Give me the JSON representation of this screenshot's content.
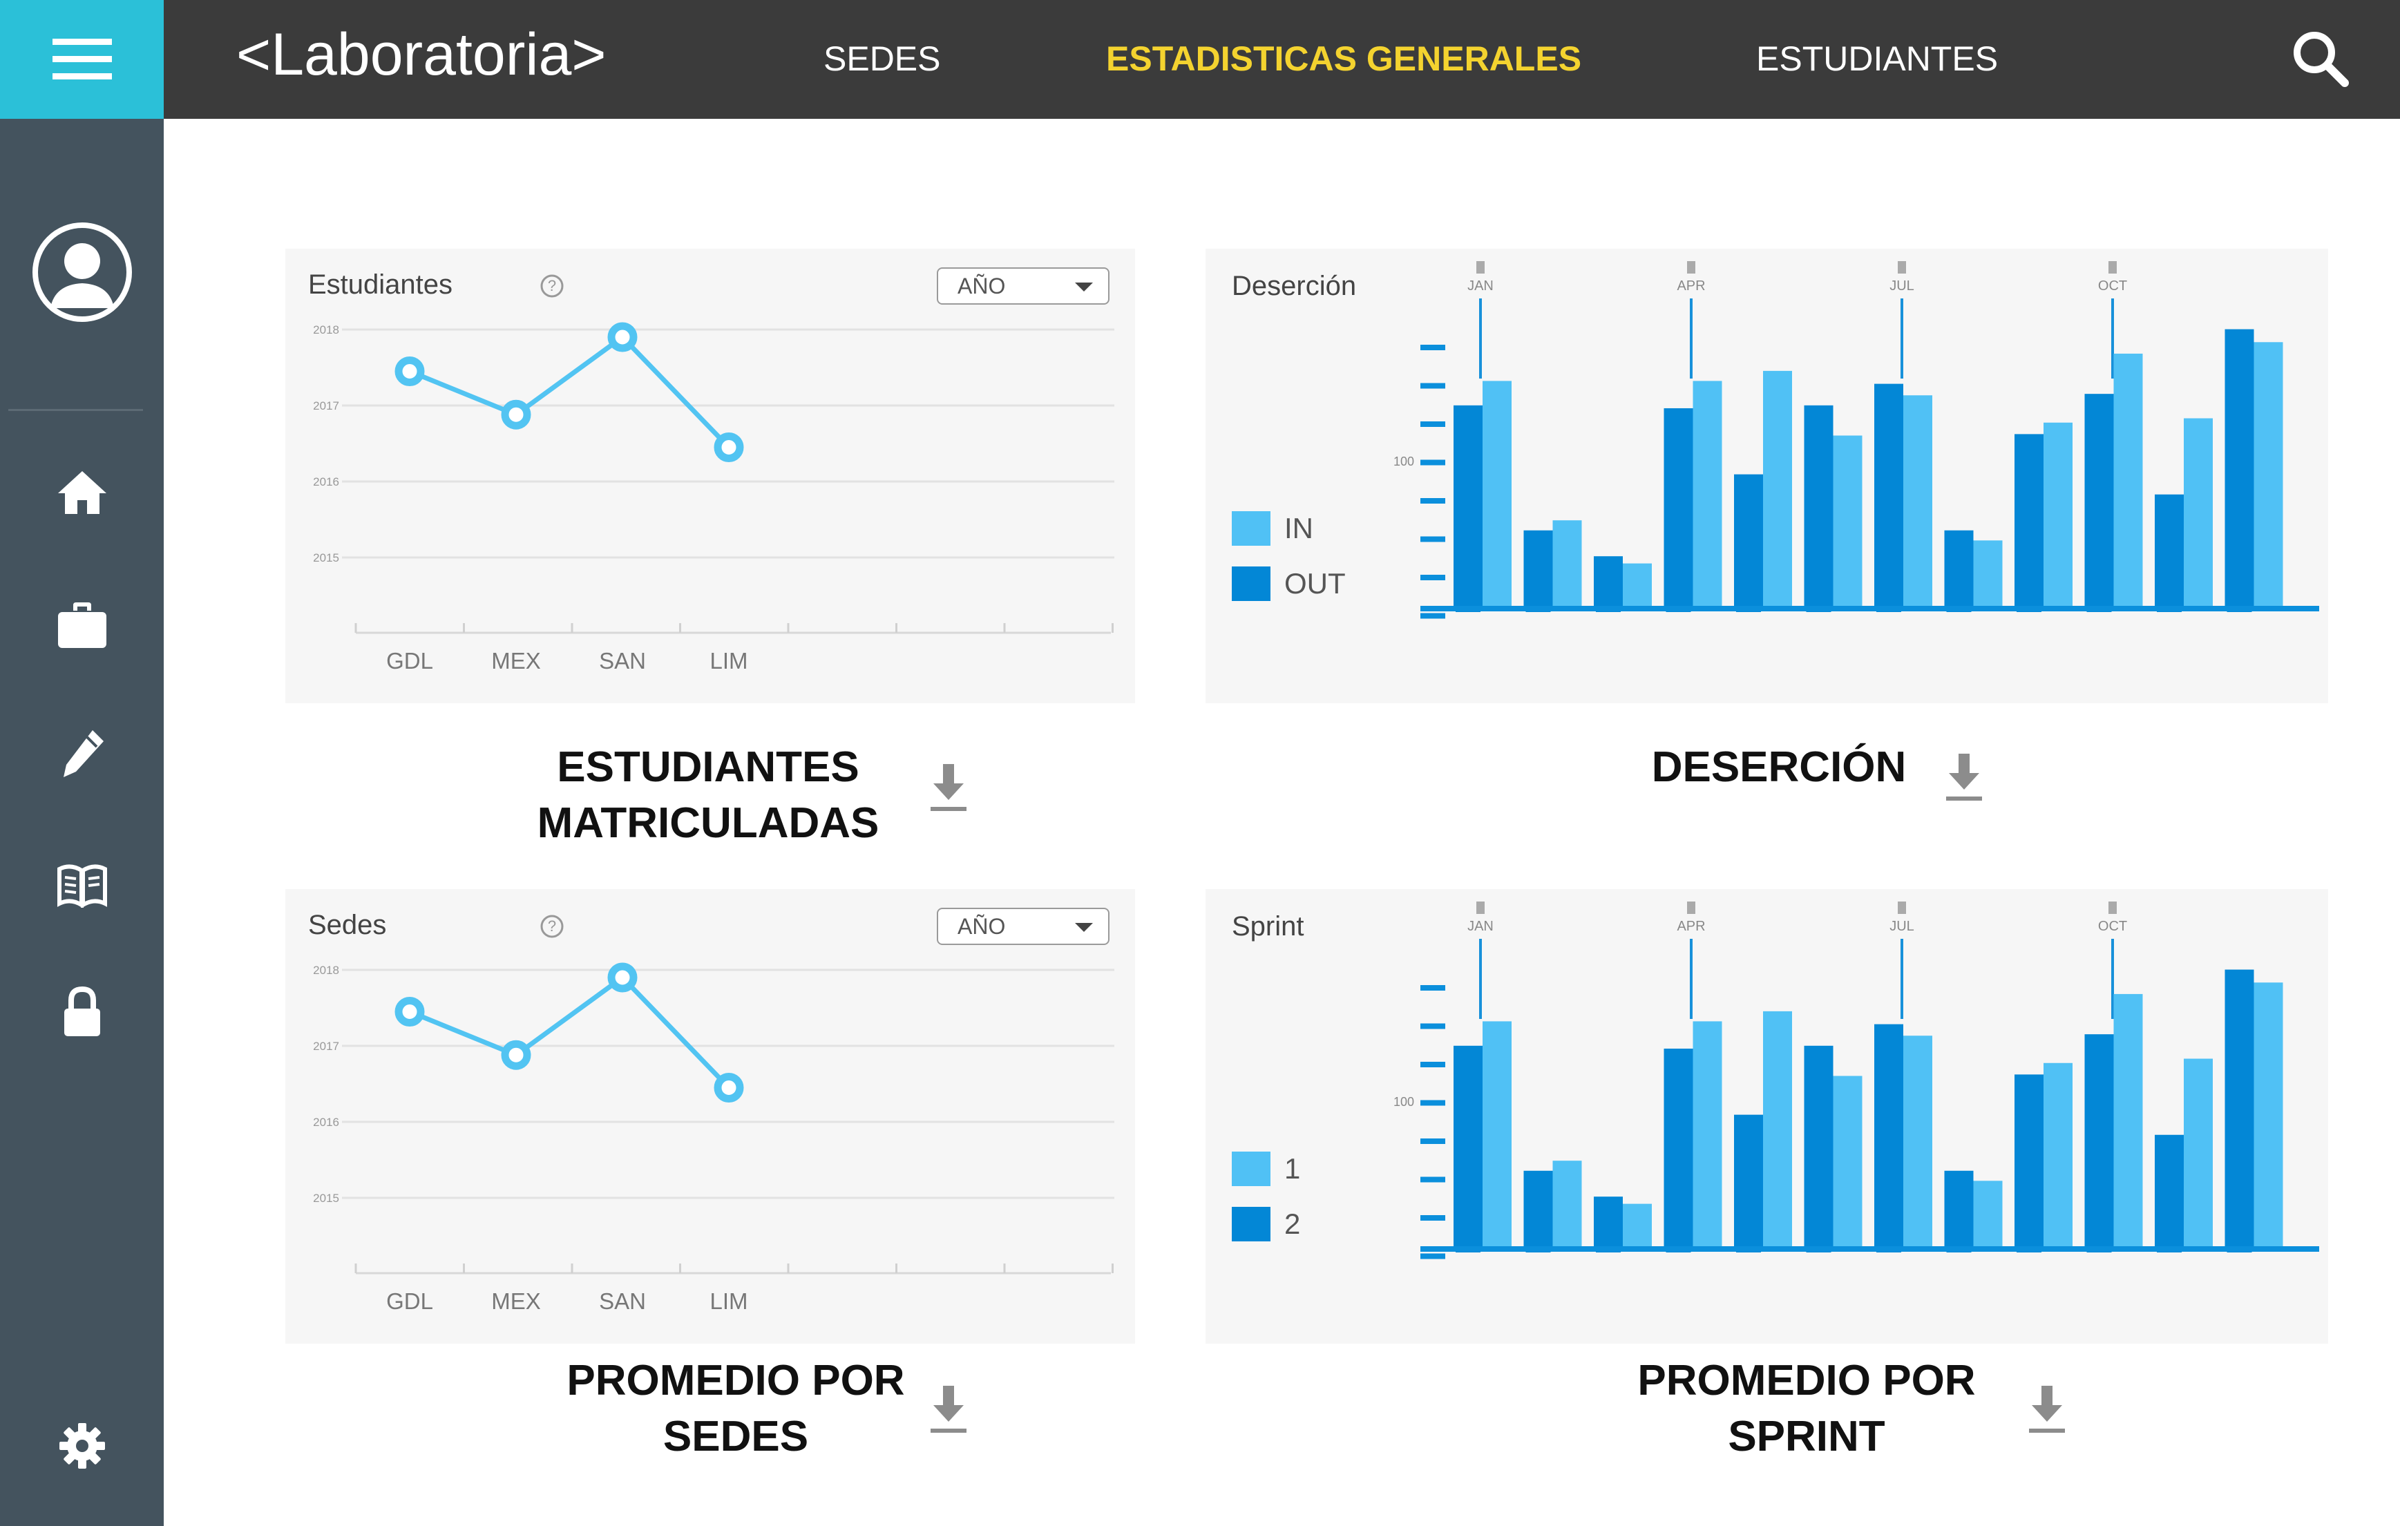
{
  "app": {
    "brand": "<Laboratoria>",
    "nav": [
      {
        "label": "SEDES",
        "active": false
      },
      {
        "label": "ESTADISTICAS GENERALES",
        "active": true
      },
      {
        "label": "ESTUDIANTES",
        "active": false
      }
    ]
  },
  "colors": {
    "menu_accent": "#2bc0d8",
    "topbar": "#3b3b3b",
    "sidebar": "#44535e",
    "nav_active": "#f4d32f",
    "line_series": "#52c4f2",
    "bar_dark": "#0387d6",
    "bar_light": "#50c1f5"
  },
  "sidebar": {
    "icons": [
      "menu-icon",
      "avatar-icon",
      "home-icon",
      "briefcase-icon",
      "pencil-icon",
      "book-icon",
      "lock-icon",
      "settings-icon"
    ]
  },
  "cards": {
    "estudiantes": {
      "title": "Estudiantes",
      "select_value": "AÑO",
      "caption_l1": "ESTUDIANTES",
      "caption_l2": "MATRICULADAS"
    },
    "desercion": {
      "title": "Deserción",
      "legend": [
        "IN",
        "OUT"
      ],
      "caption_l1": "DESERCIÓN"
    },
    "sedes": {
      "title": "Sedes",
      "select_value": "AÑO",
      "caption_l1": "PROMEDIO POR",
      "caption_l2": "SEDES"
    },
    "sprint": {
      "title": "Sprint",
      "legend": [
        "1",
        "2"
      ],
      "caption_l1": "PROMEDIO POR",
      "caption_l2": "SPRINT"
    }
  },
  "chart_data": [
    {
      "type": "line",
      "title": "Estudiantes",
      "categories": [
        "GDL",
        "MEX",
        "SAN",
        "LIM"
      ],
      "yticks": [
        "2018",
        "2017",
        "2016",
        "2015"
      ],
      "values": [
        2017.45,
        2016.88,
        2017.9,
        2016.45
      ]
    },
    {
      "type": "bar",
      "title": "Deserción",
      "months": [
        "JAN",
        "APR",
        "JUL",
        "OCT"
      ],
      "ytick": "100",
      "series": [
        {
          "name": "OUT",
          "values": [
            140,
            53,
            35,
            138,
            92,
            140,
            155,
            53,
            120,
            148,
            78,
            193
          ]
        },
        {
          "name": "IN",
          "values": [
            157,
            60,
            30,
            157,
            164,
            119,
            147,
            46,
            128,
            176,
            131,
            184
          ]
        }
      ]
    },
    {
      "type": "line",
      "title": "Sedes",
      "categories": [
        "GDL",
        "MEX",
        "SAN",
        "LIM"
      ],
      "yticks": [
        "2018",
        "2017",
        "2016",
        "2015"
      ],
      "values": [
        2017.45,
        2016.88,
        2017.9,
        2016.45
      ]
    },
    {
      "type": "bar",
      "title": "Sprint",
      "months": [
        "JAN",
        "APR",
        "JUL",
        "OCT"
      ],
      "ytick": "100",
      "series": [
        {
          "name": "2",
          "values": [
            140,
            53,
            35,
            138,
            92,
            140,
            155,
            53,
            120,
            148,
            78,
            193
          ]
        },
        {
          "name": "1",
          "values": [
            157,
            60,
            30,
            157,
            164,
            119,
            147,
            46,
            128,
            176,
            131,
            184
          ]
        }
      ]
    }
  ]
}
